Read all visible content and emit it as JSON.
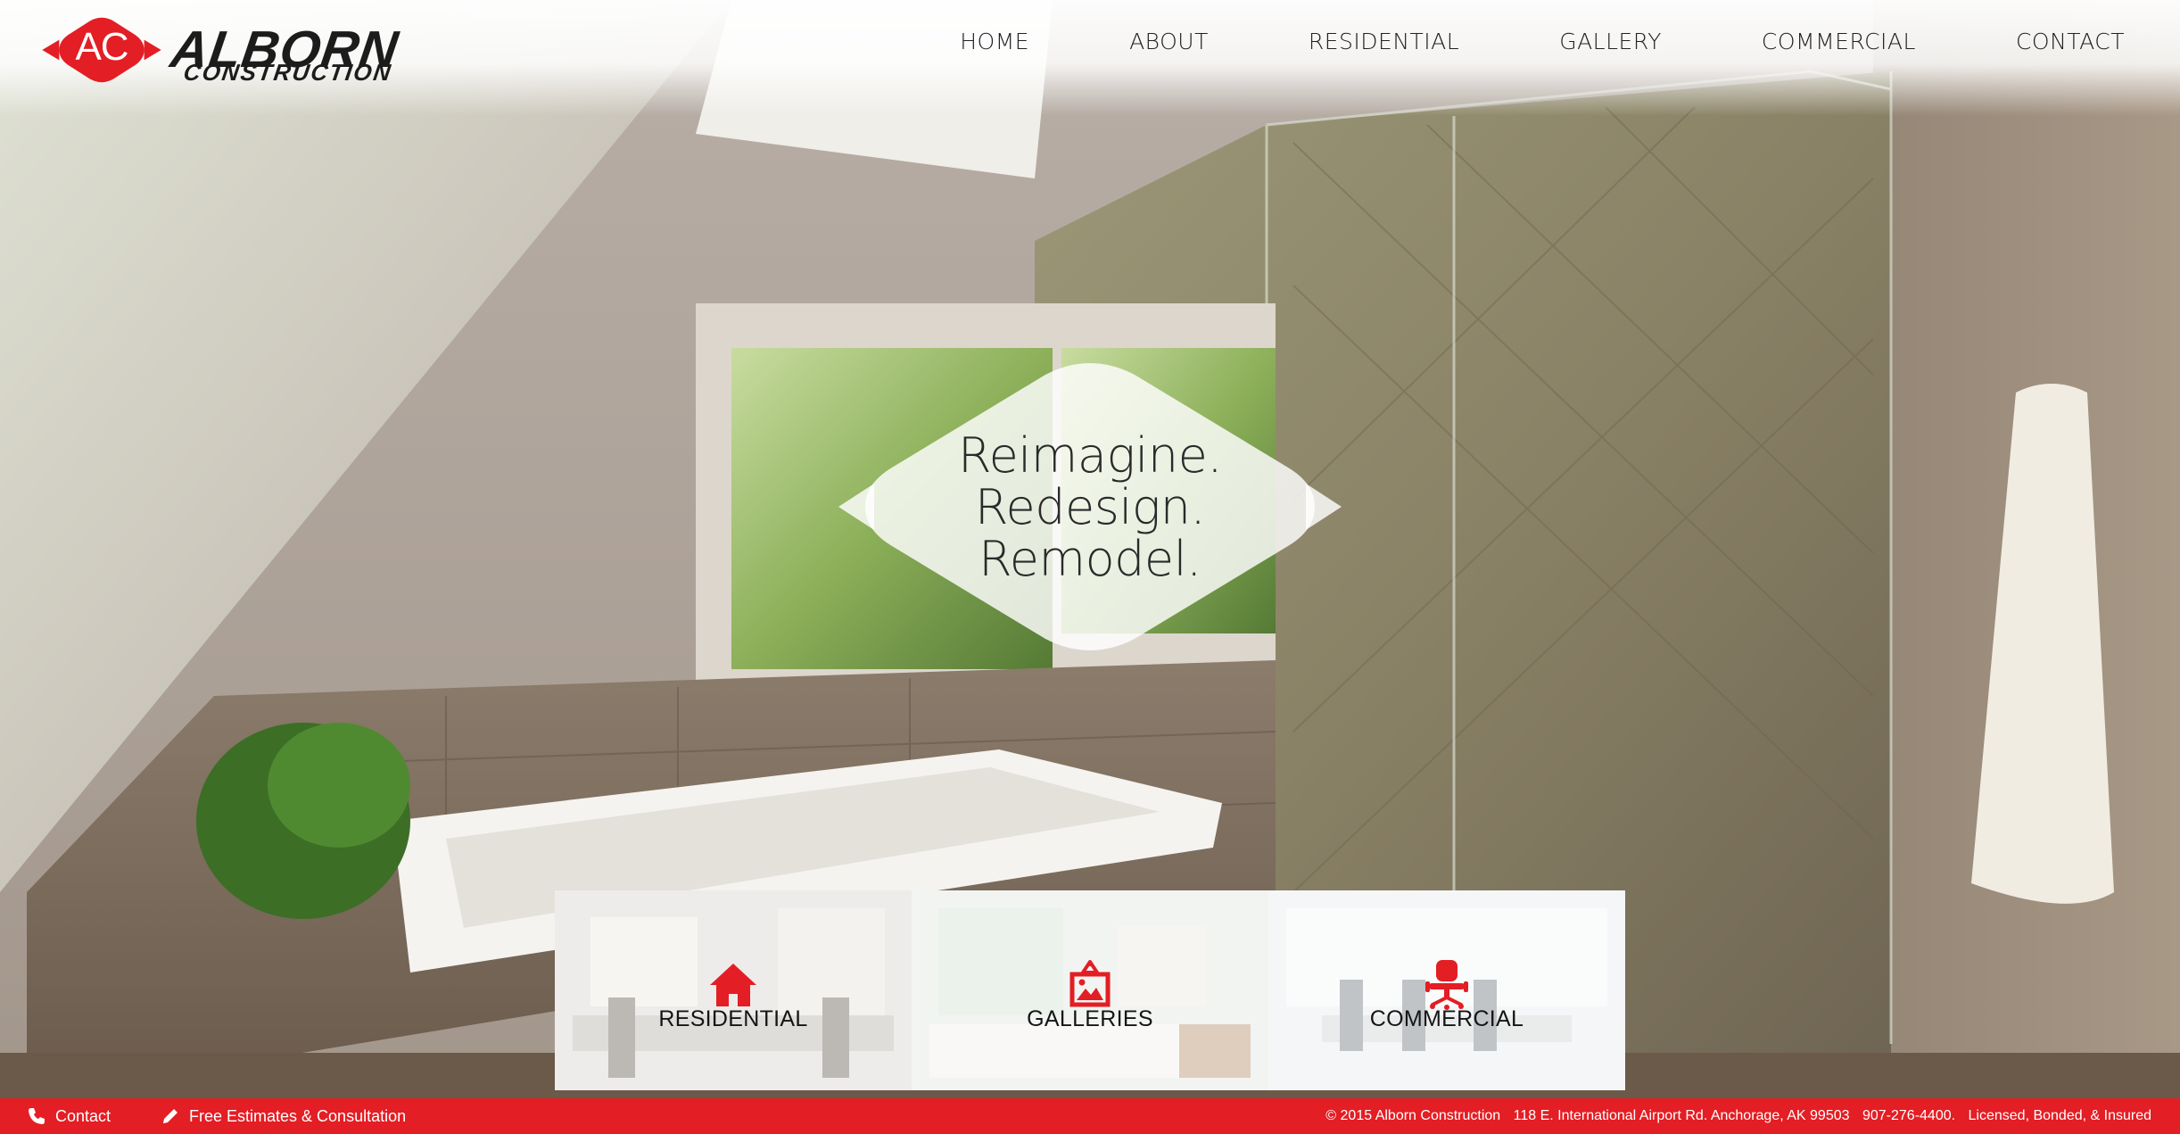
{
  "brand": {
    "monogram": "AC",
    "name": "ALBORN",
    "subname": "CONSTRUCTION",
    "color": "#e31e24"
  },
  "nav": {
    "items": [
      "HOME",
      "ABOUT",
      "RESIDENTIAL",
      "GALLERY",
      "COMMERCIAL",
      "CONTACT"
    ]
  },
  "hero": {
    "tagline": [
      "Reimagine.",
      "Redesign.",
      "Remodel."
    ]
  },
  "tiles": [
    {
      "label": "RESIDENTIAL",
      "icon": "house-icon"
    },
    {
      "label": "GALLERIES",
      "icon": "picture-frame-icon"
    },
    {
      "label": "COMMERCIAL",
      "icon": "office-chair-icon"
    }
  ],
  "footer": {
    "contact_label": "Contact",
    "estimates_label": "Free Estimates & Consultation",
    "copyright": "© 2015 Alborn Construction",
    "address": "118 E. International Airport Rd. Anchorage, AK 99503",
    "phone": "907-276-4400.",
    "license": "Licensed, Bonded, & Insured",
    "icons": [
      "phone-icon",
      "pencil-icon"
    ]
  }
}
